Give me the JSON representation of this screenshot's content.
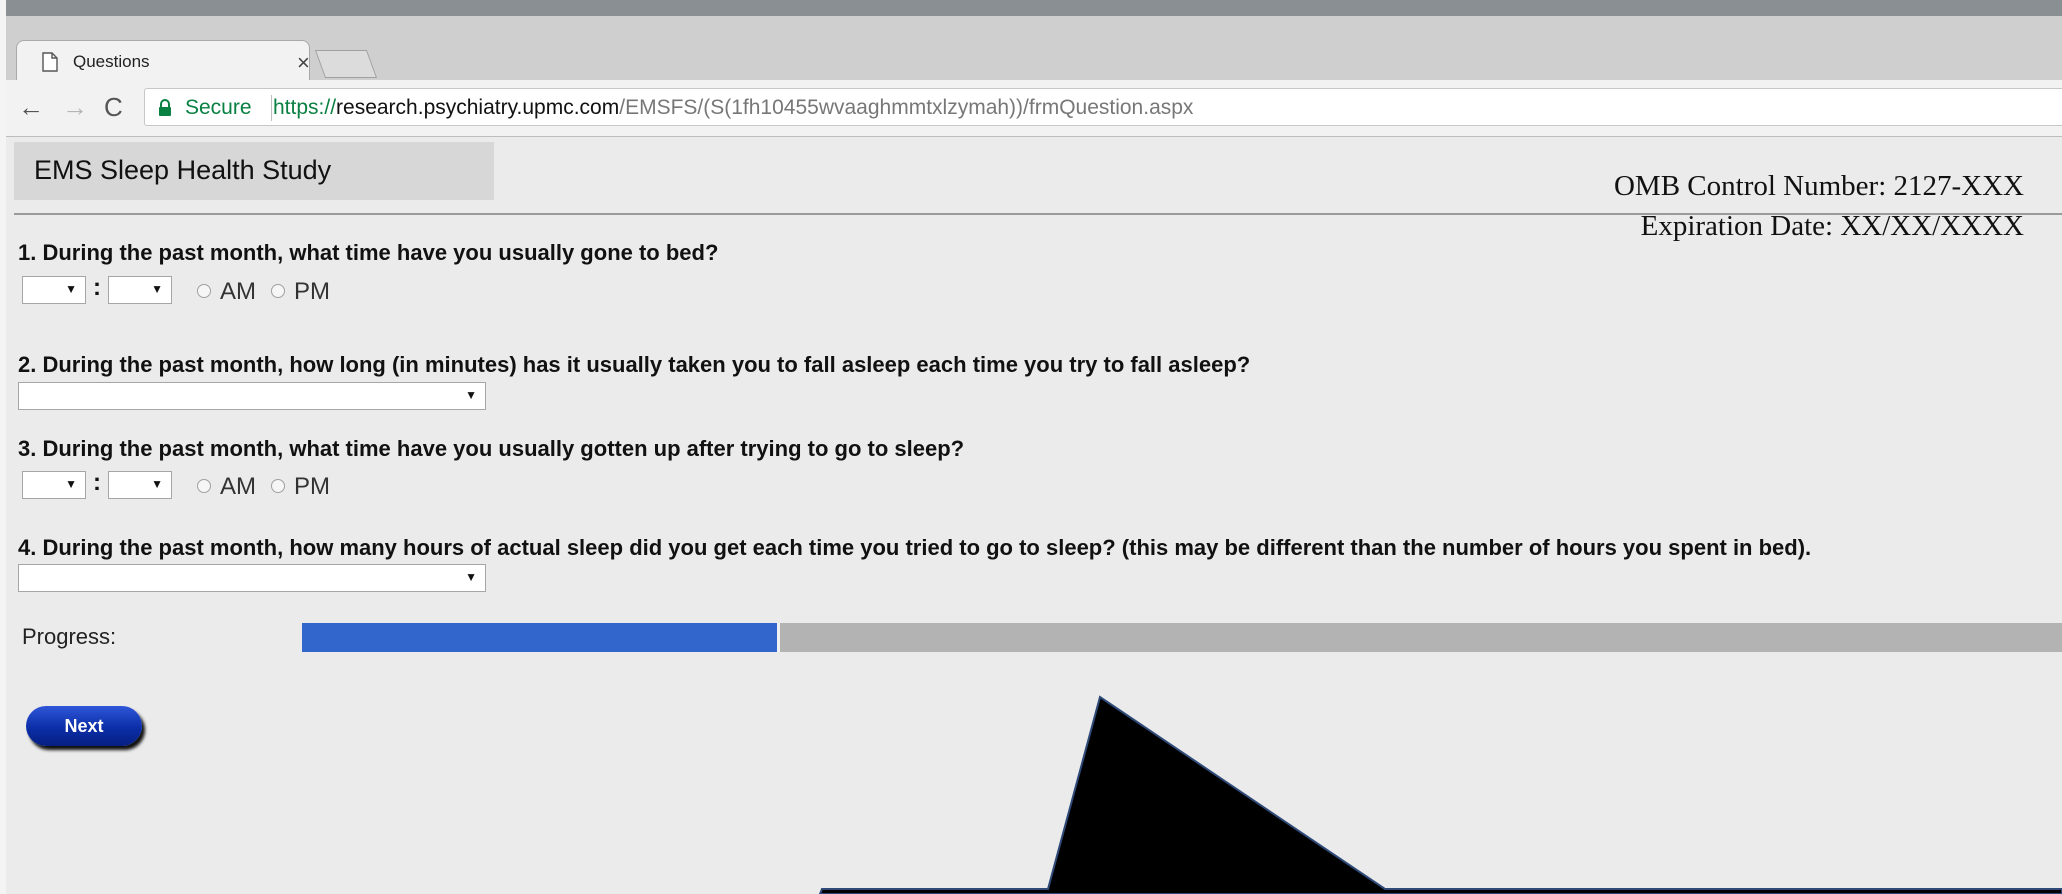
{
  "browser": {
    "tab": {
      "title": "Questions",
      "close_glyph": "×",
      "icon": "document-icon"
    },
    "nav": {
      "back_glyph": "←",
      "forward_glyph": "→",
      "reload_glyph": "C"
    },
    "address": {
      "secure_label": "Secure",
      "url_scheme": "https://",
      "url_host": "research.psychiatry.upmc.com",
      "url_path": "/EMSFS/(S(1fh10455wvaaghmmtxlzymah))/frmQuestion.aspx"
    }
  },
  "page": {
    "site_title": "EMS Sleep Health Study",
    "omb_line1": "OMB Control Number: 2127-XXX",
    "omb_line2": "Expiration Date:  XX/XX/XXXX"
  },
  "questions": [
    {
      "text": "1. During the past month, what time have you usually gone to bed?",
      "hour_value": "",
      "minute_value": "",
      "am": "AM",
      "pm": "PM"
    },
    {
      "text": "2. During the past month, how long (in minutes) has it usually taken you to fall asleep each time you try to fall asleep?",
      "value": ""
    },
    {
      "text": "3. During the past month, what time have you usually gotten up after trying to go to sleep?",
      "hour_value": "",
      "minute_value": "",
      "am": "AM",
      "pm": "PM"
    },
    {
      "text": "4. During the past month, how many hours of actual sleep did you get each time you tried to go to sleep? (this may be different than the number of hours you spent in bed).",
      "value": ""
    }
  ],
  "time_separator": ":",
  "dropdown_arrow": "▼",
  "progress": {
    "label": "Progress:",
    "fraction": 0.27
  },
  "next_button": {
    "label": "Next"
  },
  "colors": {
    "progress_fill": "#3366cc",
    "progress_track": "#b3b3b3",
    "secure_green": "#0b8043",
    "button_blue": "#0b2ea8",
    "page_background": "#ebebeb"
  }
}
